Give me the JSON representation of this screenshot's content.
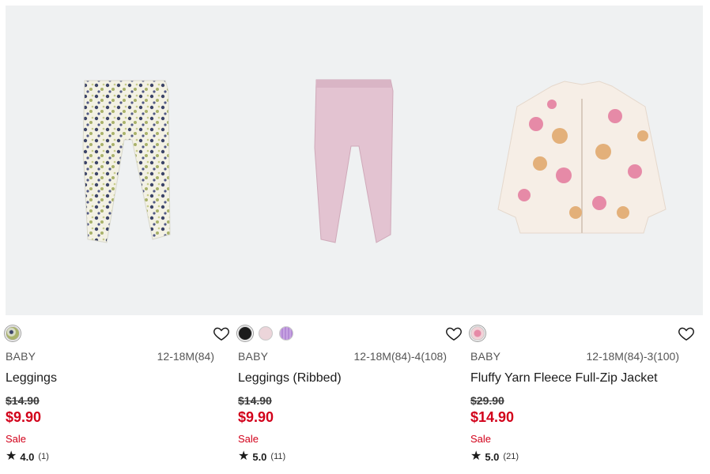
{
  "products": [
    {
      "gender": "BABY",
      "sizes": "12-18M(84)",
      "name": "Leggings",
      "original_price": "$14.90",
      "sale_price": "$9.90",
      "sale_flag": "Sale",
      "rating": "4.0",
      "reviews": "(1)",
      "image": "floral-leggings",
      "swatches": [
        {
          "color": "#d8dcc8",
          "pattern": "floral"
        }
      ]
    },
    {
      "gender": "BABY",
      "sizes": "12-18M(84)-4(108)",
      "name": "Leggings (Ribbed)",
      "original_price": "$14.90",
      "sale_price": "$9.90",
      "sale_flag": "Sale",
      "rating": "5.0",
      "reviews": "(11)",
      "image": "pink-ribbed-leggings",
      "swatches": [
        {
          "color": "#1c1c1c"
        },
        {
          "color": "#ecd5da"
        },
        {
          "color": "#c7a3e2",
          "pattern": "ribbed"
        }
      ]
    },
    {
      "gender": "BABY",
      "sizes": "12-18M(84)-3(100)",
      "name": "Fluffy Yarn Fleece Full-Zip Jacket",
      "original_price": "$29.90",
      "sale_price": "$14.90",
      "sale_flag": "Sale",
      "rating": "5.0",
      "reviews": "(21)",
      "image": "floral-fleece-jacket",
      "swatches": [
        {
          "color": "#f1d3d8",
          "pattern": "floral"
        }
      ]
    }
  ],
  "colors": {
    "sale_red": "#d2001a",
    "image_background": "#eff1f2",
    "text": "#1b1b1b"
  },
  "icons": {
    "favorite": "heart-outline-icon",
    "rating": "star-icon"
  }
}
